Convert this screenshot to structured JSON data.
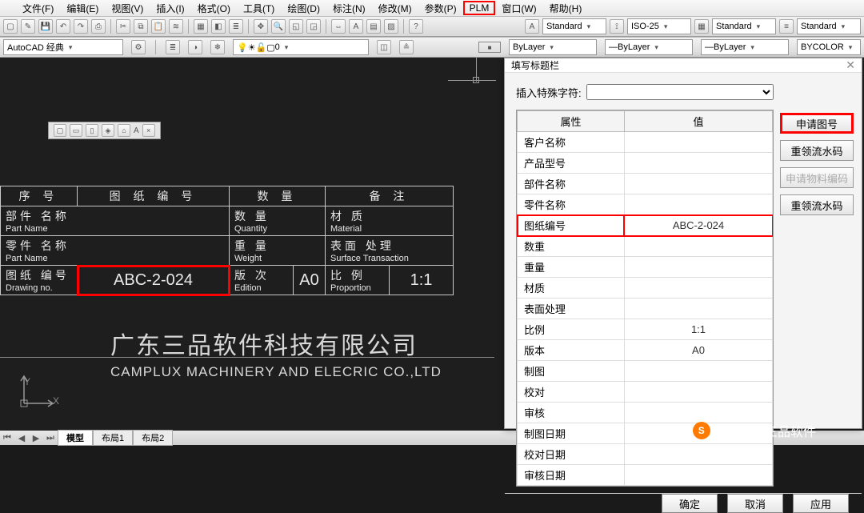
{
  "menubar": [
    {
      "label": "文件(F)",
      "name": "menu-file"
    },
    {
      "label": "编辑(E)",
      "name": "menu-edit"
    },
    {
      "label": "视图(V)",
      "name": "menu-view"
    },
    {
      "label": "插入(I)",
      "name": "menu-insert"
    },
    {
      "label": "格式(O)",
      "name": "menu-format"
    },
    {
      "label": "工具(T)",
      "name": "menu-tools"
    },
    {
      "label": "绘图(D)",
      "name": "menu-draw"
    },
    {
      "label": "标注(N)",
      "name": "menu-dim"
    },
    {
      "label": "修改(M)",
      "name": "menu-modify"
    },
    {
      "label": "参数(P)",
      "name": "menu-param"
    },
    {
      "label": "PLM",
      "name": "menu-plm",
      "highlight": true
    },
    {
      "label": "窗口(W)",
      "name": "menu-window"
    },
    {
      "label": "帮助(H)",
      "name": "menu-help"
    }
  ],
  "row1": {
    "textstyle": "Standard",
    "dimstyle": "ISO-25",
    "tablestyle": "Standard",
    "mlstyle": "Standard"
  },
  "row2": {
    "workspace": "AutoCAD 经典",
    "layer_zero": "0",
    "bylayer": "ByLayer",
    "bylayer2": "ByLayer",
    "bylayer3": "ByLayer",
    "bycolor": "BYCOLOR"
  },
  "titleblock": {
    "headers": {
      "seq": "序 号",
      "drawno": "图 纸 编 号",
      "qty": "数 量",
      "remark": "备 注"
    },
    "rows": [
      {
        "cn": "部件 名称",
        "en": "Part Name",
        "c2cn": "数 量",
        "c2en": "Quantity",
        "c3cn": "材 质",
        "c3en": "Material"
      },
      {
        "cn": "零件 名称",
        "en": "Part Name",
        "c2cn": "重 量",
        "c2en": "Weight",
        "c3cn": "表面 处理",
        "c3en": "Surface Transaction"
      },
      {
        "cn": "图纸 编号",
        "en": "Drawing no.",
        "val": "ABC-2-024",
        "c2cn": "版 次",
        "c2en": "Edition",
        "a0": "A0",
        "c3cn": "比 例",
        "c3en": "Proportion",
        "ratio": "1:1"
      }
    ]
  },
  "company": {
    "cn": "广东三品软件科技有限公司",
    "en": "CAMPLUX MACHINERY AND ELECRIC CO.,LTD"
  },
  "ucs": {
    "x": "X",
    "y": "Y"
  },
  "tabs": {
    "model": "模型",
    "layout1": "布局1",
    "layout2": "布局2"
  },
  "dialog": {
    "title": "填写标题栏",
    "insert_label": "插入特殊字符:",
    "col_prop": "属性",
    "col_val": "值",
    "props": [
      {
        "k": "客户名称",
        "v": ""
      },
      {
        "k": "产品型号",
        "v": ""
      },
      {
        "k": "部件名称",
        "v": ""
      },
      {
        "k": "零件名称",
        "v": ""
      },
      {
        "k": "图纸编号",
        "v": "ABC-2-024",
        "hl": true
      },
      {
        "k": "数重",
        "v": ""
      },
      {
        "k": "重量",
        "v": ""
      },
      {
        "k": "材质",
        "v": ""
      },
      {
        "k": "表面处理",
        "v": ""
      },
      {
        "k": "比例",
        "v": "1:1"
      },
      {
        "k": "版本",
        "v": "A0"
      },
      {
        "k": "制图",
        "v": ""
      },
      {
        "k": "校对",
        "v": ""
      },
      {
        "k": "审核",
        "v": ""
      },
      {
        "k": "制图日期",
        "v": ""
      },
      {
        "k": "校对日期",
        "v": ""
      },
      {
        "k": "审核日期",
        "v": ""
      }
    ],
    "side": [
      {
        "l": "申请图号",
        "hl": true
      },
      {
        "l": "重领流水码"
      },
      {
        "l": "申请物料编码",
        "dis": true
      },
      {
        "l": "重领流水码"
      }
    ],
    "foot": {
      "ok": "确定",
      "cancel": "取消",
      "apply": "应用"
    }
  },
  "watermark": "搜狐号@三品软件"
}
